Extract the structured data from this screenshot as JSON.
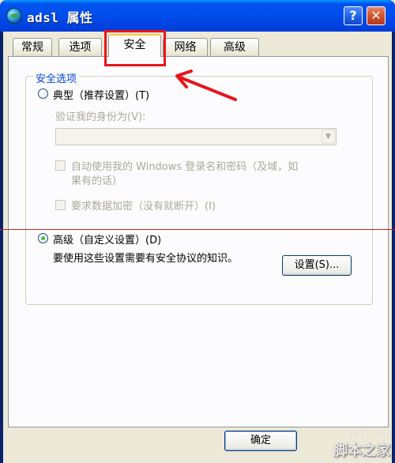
{
  "window": {
    "title": "adsl 属性",
    "help_label": "?",
    "close_label": "✕"
  },
  "tabs": [
    {
      "label": "常规",
      "active": false
    },
    {
      "label": "选项",
      "active": false
    },
    {
      "label": "安全",
      "active": true
    },
    {
      "label": "网络",
      "active": false
    },
    {
      "label": "高级",
      "active": false
    }
  ],
  "security": {
    "group_label": "安全选项",
    "typical_label": "典型（推荐设置）(T)",
    "verify_label": "验证我的身份为(V):",
    "combo_value": "",
    "auto_windows_label_line1": "自动使用我的 Windows 登录名和密码（及域，如",
    "auto_windows_label_line2": "果有的话）",
    "encryption_label": "要求数据加密（没有就断开）(I)",
    "advanced_label": "高级（自定义设置）(D)",
    "advanced_hint": "要使用这些设置需要有安全协议的知识。",
    "settings_button": "设置(S)..."
  },
  "footer": {
    "ok_button": "确定"
  },
  "watermark": {
    "url": "jb51.net",
    "brand": "脚本之家"
  },
  "colors": {
    "titlebar": "#0053ee",
    "group_label": "#0046d5",
    "annotation": "#e8141c"
  }
}
